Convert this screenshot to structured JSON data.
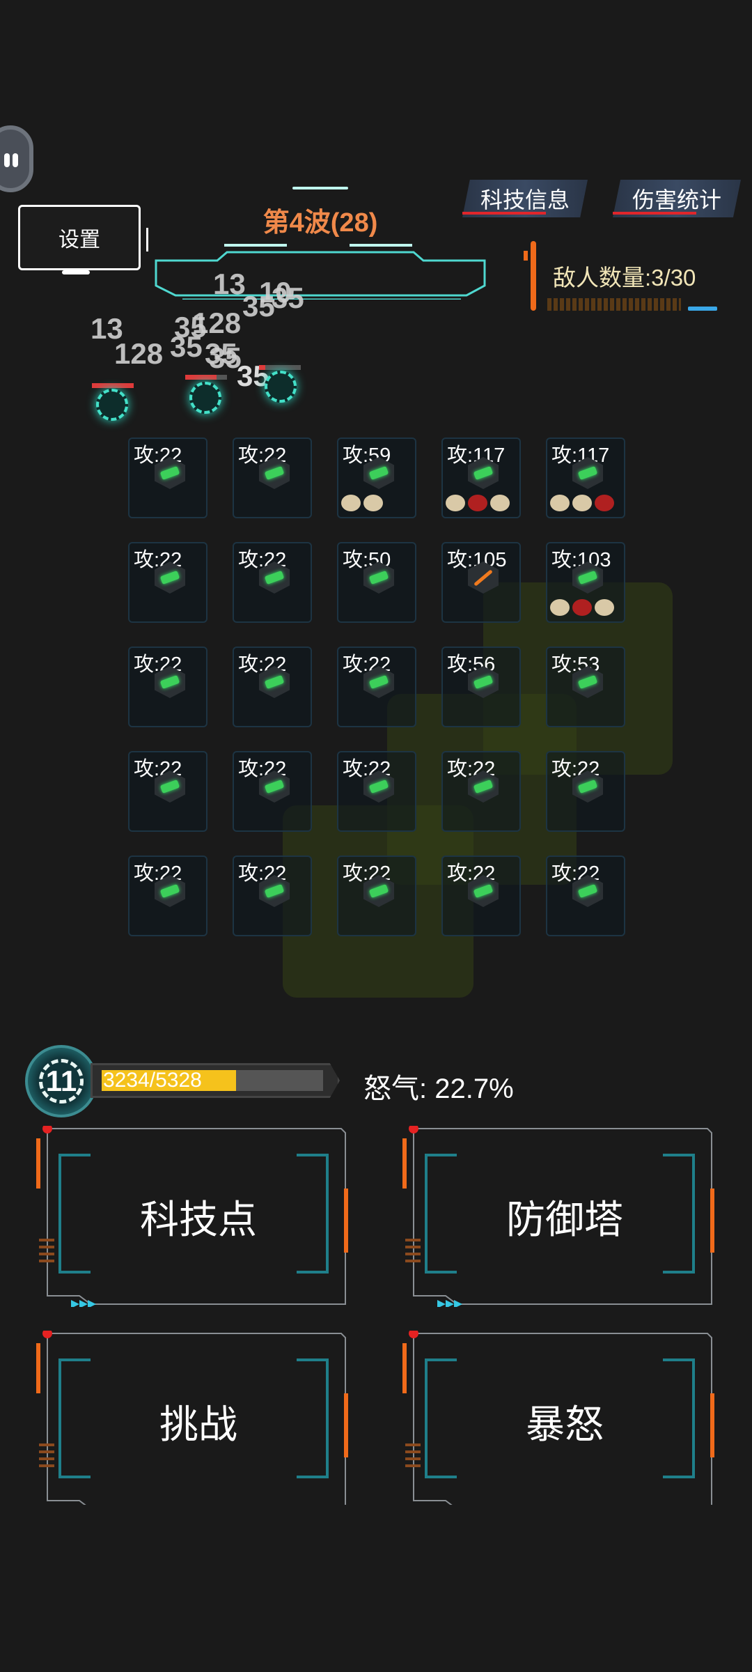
{
  "header": {
    "settings_label": "设置",
    "wave_title": "第4波(28)",
    "tab_tech": "科技信息",
    "tab_damage": "伤害统计",
    "enemy_count": "敌人数量:3/30"
  },
  "damage_numbers": [
    "13",
    "128",
    "13",
    "10",
    "35",
    "35",
    "128",
    "35",
    "35",
    "35",
    "35",
    "35"
  ],
  "grid": {
    "rows": [
      [
        {
          "atk": "攻:22",
          "weapon": "green-gun-icon",
          "mods": []
        },
        {
          "atk": "攻:22",
          "weapon": "green-gun-icon",
          "mods": []
        },
        {
          "atk": "攻:59",
          "weapon": "green-gun-icon",
          "mods": [
            "shell-icon",
            "shell-icon"
          ]
        },
        {
          "atk": "攻:117",
          "weapon": "green-gun-icon",
          "mods": [
            "shell-icon",
            "red-beast-icon",
            "shell-icon"
          ]
        },
        {
          "atk": "攻:117",
          "weapon": "green-gun-icon",
          "mods": [
            "shell-icon",
            "shell-icon",
            "red-beast-icon"
          ]
        }
      ],
      [
        {
          "atk": "攻:22",
          "weapon": "green-gun-icon",
          "mods": []
        },
        {
          "atk": "攻:22",
          "weapon": "green-gun-icon",
          "mods": []
        },
        {
          "atk": "攻:50",
          "weapon": "green-gun-icon",
          "mods": []
        },
        {
          "atk": "攻:105",
          "weapon": "rocket-icon",
          "mods": []
        },
        {
          "atk": "攻:103",
          "weapon": "green-gun-icon",
          "mods": [
            "shell-icon",
            "red-beast-icon",
            "shell-icon"
          ]
        }
      ],
      [
        {
          "atk": "攻:22",
          "weapon": "green-gun-icon",
          "mods": []
        },
        {
          "atk": "攻:22",
          "weapon": "green-gun-icon",
          "mods": []
        },
        {
          "atk": "攻:22",
          "weapon": "green-gun-icon",
          "mods": []
        },
        {
          "atk": "攻:56",
          "weapon": "green-gun-icon",
          "mods": []
        },
        {
          "atk": "攻:53",
          "weapon": "green-gun-icon",
          "mods": []
        }
      ],
      [
        {
          "atk": "攻:22",
          "weapon": "green-gun-icon",
          "mods": []
        },
        {
          "atk": "攻:22",
          "weapon": "green-gun-icon",
          "mods": []
        },
        {
          "atk": "攻:22",
          "weapon": "green-gun-icon",
          "mods": []
        },
        {
          "atk": "攻:22",
          "weapon": "green-gun-icon",
          "mods": []
        },
        {
          "atk": "攻:22",
          "weapon": "green-gun-icon",
          "mods": []
        }
      ],
      [
        {
          "atk": "攻:22",
          "weapon": "green-gun-icon",
          "mods": []
        },
        {
          "atk": "攻:22",
          "weapon": "green-gun-icon",
          "mods": []
        },
        {
          "atk": "攻:22",
          "weapon": "green-gun-icon",
          "mods": []
        },
        {
          "atk": "攻:22",
          "weapon": "green-gun-icon",
          "mods": []
        },
        {
          "atk": "攻:22",
          "weapon": "green-gun-icon",
          "mods": []
        }
      ]
    ]
  },
  "player": {
    "level": "11",
    "exp_text": "3234/5328",
    "exp_fraction": 0.607,
    "rage_text": "怒气: 22.7%"
  },
  "actions": {
    "tech_points": "科技点",
    "defense_tower": "防御塔",
    "challenge": "挑战",
    "rage": "暴怒"
  },
  "colors": {
    "accent_orange": "#f0894a",
    "exp_yellow": "#f5c21c",
    "neon_cyan": "#43e0c8",
    "hp_red": "#e03a3a"
  }
}
